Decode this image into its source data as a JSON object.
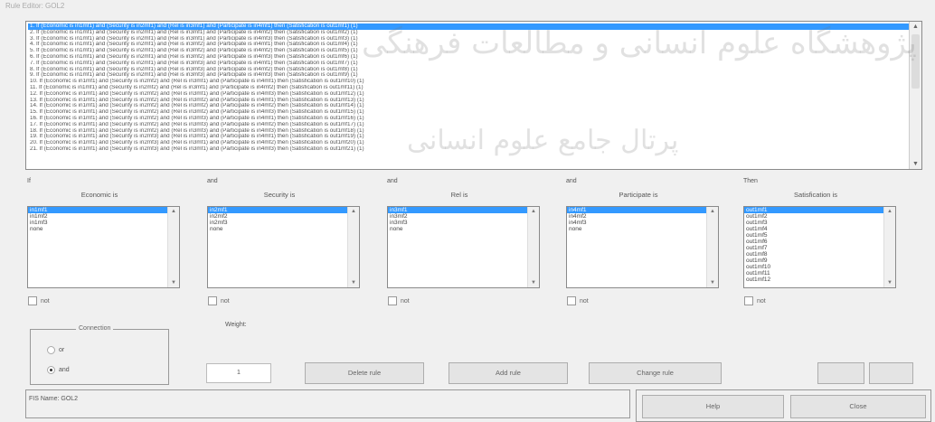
{
  "window": {
    "title": "Rule Editor: GOL2"
  },
  "rules": [
    "1. If (Economic is in1mf1) and (Security is in2mf1) and (Rel is in3mf1) and (Participate is in4mf1) then (Satisfication is out1mf1) (1)",
    "2. If (Economic is in1mf1) and (Security is in2mf1) and (Rel is in3mf1) and (Participate is in4mf2) then (Satisfication is out1mf2) (1)",
    "3. If (Economic is in1mf1) and (Security is in2mf1) and (Rel is in3mf1) and (Participate is in4mf3) then (Satisfication is out1mf3) (1)",
    "4. If (Economic is in1mf1) and (Security is in2mf1) and (Rel is in3mf2) and (Participate is in4mf1) then (Satisfication is out1mf4) (1)",
    "5. If (Economic is in1mf1) and (Security is in2mf1) and (Rel is in3mf2) and (Participate is in4mf2) then (Satisfication is out1mf5) (1)",
    "6. If (Economic is in1mf1) and (Security is in2mf1) and (Rel is in3mf2) and (Participate is in4mf3) then (Satisfication is out1mf6) (1)",
    "7. If (Economic is in1mf1) and (Security is in2mf1) and (Rel is in3mf3) and (Participate is in4mf1) then (Satisfication is out1mf7) (1)",
    "8. If (Economic is in1mf1) and (Security is in2mf1) and (Rel is in3mf3) and (Participate is in4mf2) then (Satisfication is out1mf8) (1)",
    "9. If (Economic is in1mf1) and (Security is in2mf1) and (Rel is in3mf3) and (Participate is in4mf3) then (Satisfication is out1mf9) (1)",
    "10. If (Economic is in1mf1) and (Security is in2mf2) and (Rel is in3mf1) and (Participate is in4mf1) then (Satisfication is out1mf10) (1)",
    "11. If (Economic is in1mf1) and (Security is in2mf2) and (Rel is in3mf1) and (Participate is in4mf2) then (Satisfication is out1mf11) (1)",
    "12. If (Economic is in1mf1) and (Security is in2mf2) and (Rel is in3mf1) and (Participate is in4mf3) then (Satisfication is out1mf12) (1)",
    "13. If (Economic is in1mf1) and (Security is in2mf2) and (Rel is in3mf2) and (Participate is in4mf1) then (Satisfication is out1mf13) (1)",
    "14. If (Economic is in1mf1) and (Security is in2mf2) and (Rel is in3mf2) and (Participate is in4mf2) then (Satisfication is out1mf14) (1)",
    "15. If (Economic is in1mf1) and (Security is in2mf2) and (Rel is in3mf2) and (Participate is in4mf3) then (Satisfication is out1mf15) (1)",
    "16. If (Economic is in1mf1) and (Security is in2mf2) and (Rel is in3mf3) and (Participate is in4mf1) then (Satisfication is out1mf16) (1)",
    "17. If (Economic is in1mf1) and (Security is in2mf2) and (Rel is in3mf3) and (Participate is in4mf2) then (Satisfication is out1mf17) (1)",
    "18. If (Economic is in1mf1) and (Security is in2mf2) and (Rel is in3mf3) and (Participate is in4mf3) then (Satisfication is out1mf18) (1)",
    "19. If (Economic is in1mf1) and (Security is in2mf3) and (Rel is in3mf1) and (Participate is in4mf1) then (Satisfication is out1mf19) (1)",
    "20. If (Economic is in1mf1) and (Security is in2mf3) and (Rel is in3mf1) and (Participate is in4mf2) then (Satisfication is out1mf20) (1)",
    "21. If (Economic is in1mf1) and (Security is in2mf3) and (Rel is in3mf1) and (Participate is in4mf3) then (Satisfication is out1mf21) (1)"
  ],
  "watermark": {
    "line1": "پژوهشگاه علوم انسانی و مطالعات فرهنگی",
    "line2": "پرتال جامع علوم انسانی"
  },
  "connectors": {
    "if": "If",
    "and1": "and",
    "and2": "and",
    "and3": "and",
    "then": "Then"
  },
  "variables": [
    {
      "title": "Economic is",
      "items": [
        "in1mf1",
        "in1mf2",
        "in1mf3",
        "none"
      ],
      "selected": 0
    },
    {
      "title": "Security is",
      "items": [
        "in2mf1",
        "in2mf2",
        "in2mf3",
        "none"
      ],
      "selected": 0
    },
    {
      "title": "Rel is",
      "items": [
        "in3mf1",
        "in3mf2",
        "in3mf3",
        "none"
      ],
      "selected": 0
    },
    {
      "title": "Participate is",
      "items": [
        "in4mf1",
        "in4mf2",
        "in4mf3",
        "none"
      ],
      "selected": 0
    },
    {
      "title": "Satisfication is",
      "items": [
        "out1mf1",
        "out1mf2",
        "out1mf3",
        "out1mf4",
        "out1mf5",
        "out1mf6",
        "out1mf7",
        "out1mf8",
        "out1mf9",
        "out1mf10",
        "out1mf11",
        "out1mf12"
      ],
      "selected": 0
    }
  ],
  "not_label": "not",
  "connection": {
    "title": "Connection",
    "options": [
      "or",
      "and"
    ],
    "selected": "and"
  },
  "weight": {
    "label": "Weight:",
    "value": "1"
  },
  "buttons": {
    "delete": "Delete rule",
    "add": "Add rule",
    "change": "Change rule",
    "help": "Help",
    "close": "Close"
  },
  "status": {
    "text": "FIS Name: GOL2"
  },
  "colors": {
    "selection": "#3399ff"
  }
}
